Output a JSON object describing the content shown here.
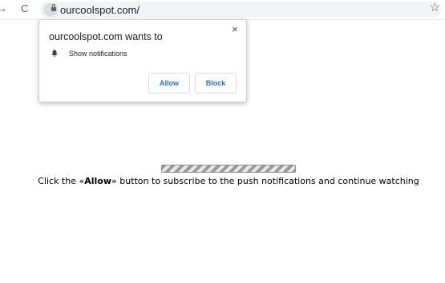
{
  "browser": {
    "back_icon": "→",
    "reload_icon": "C",
    "url": "ourcoolspot.com/",
    "star_icon": "☆"
  },
  "popup": {
    "title": "ourcoolspot.com wants to",
    "close_icon": "×",
    "permission": "Show notifications",
    "allow_label": "Allow",
    "block_label": "Block"
  },
  "page": {
    "progress": 1.0,
    "message_before": "Click the «",
    "message_bold": "Allow",
    "message_after": "» button to subscribe to the push notifications and continue watching"
  },
  "colors": {
    "accent": "#1a73e8",
    "icon": "#5f6368"
  }
}
